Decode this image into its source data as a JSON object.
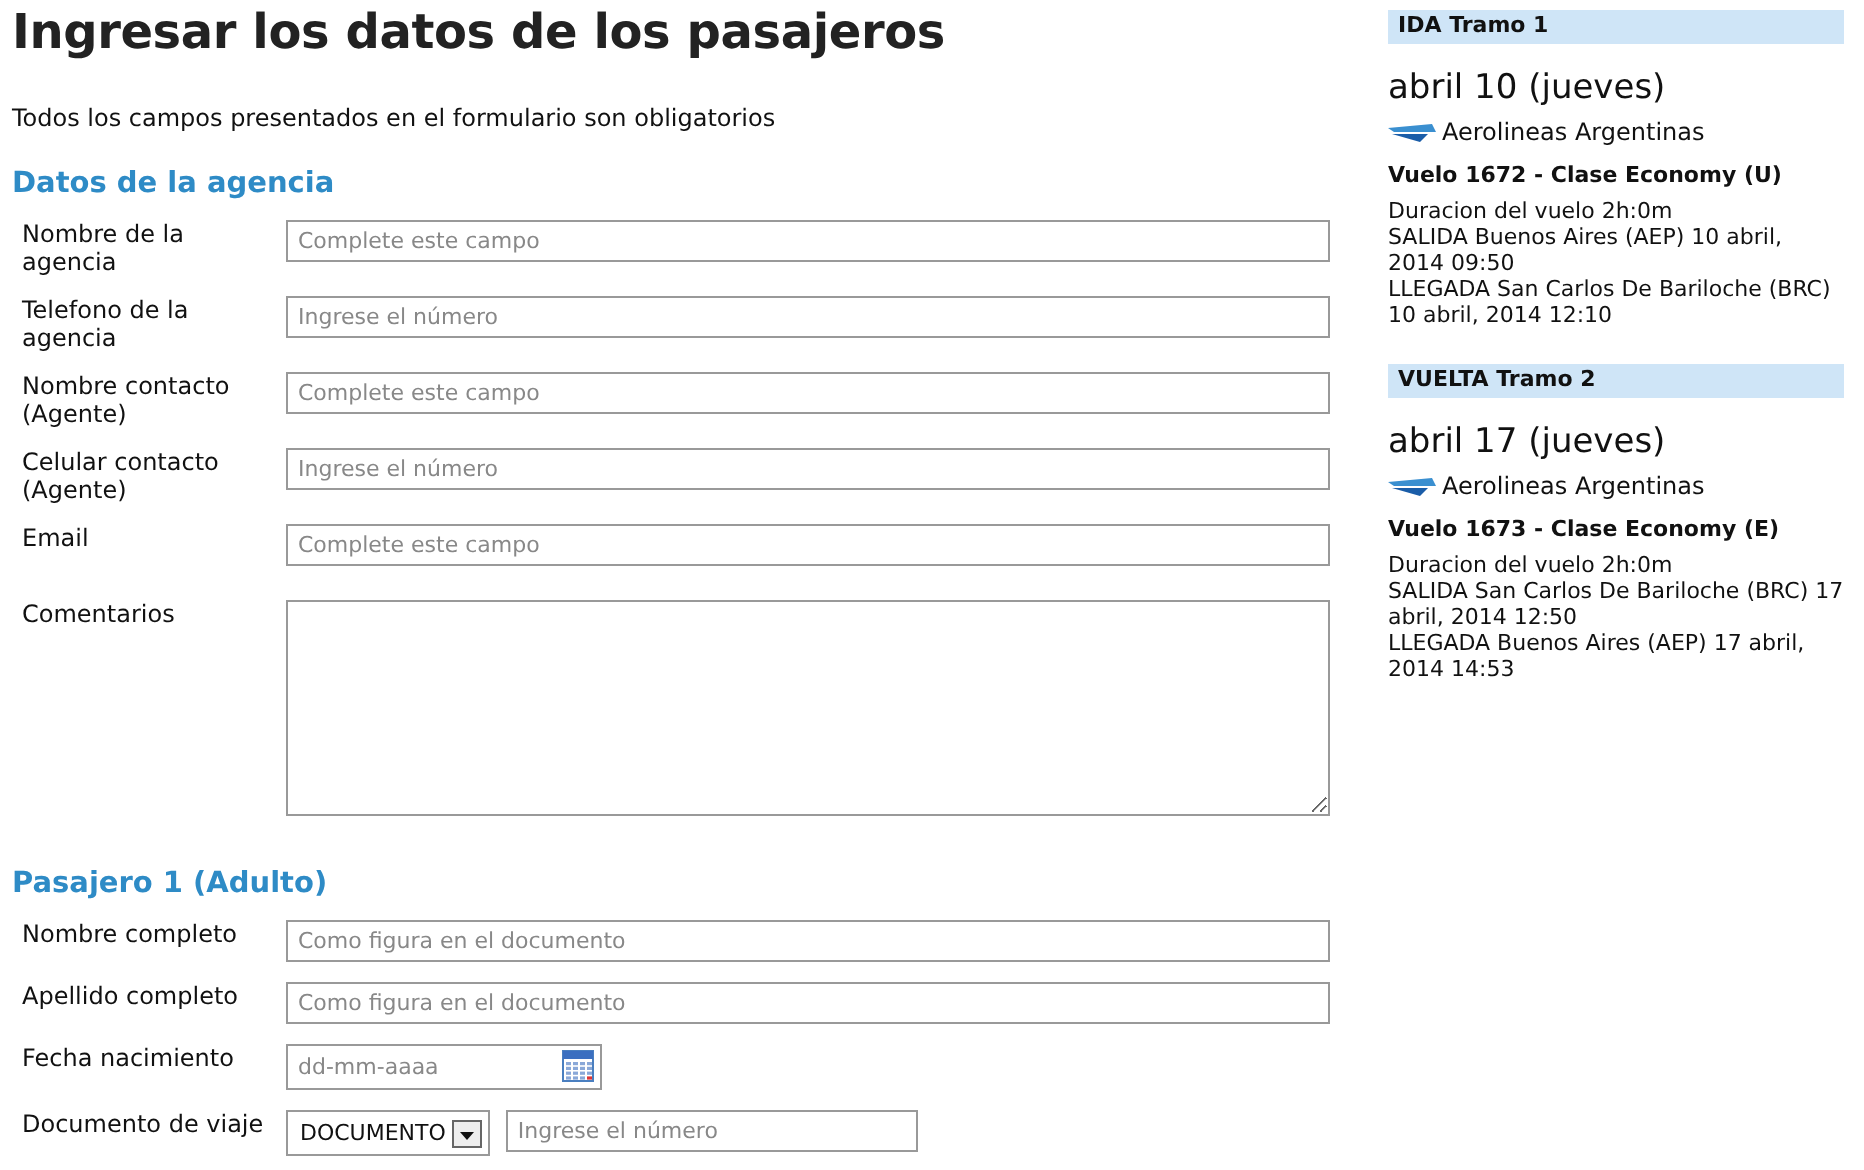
{
  "title": "Ingresar los datos de los pasajeros",
  "note": "Todos los campos presentados en el formulario son obligatorios",
  "sections": [
    {
      "heading": "Datos de la agencia",
      "fields": [
        {
          "kind": "text",
          "label": "Nombre de la agencia",
          "placeholder": "Complete este campo"
        },
        {
          "kind": "text",
          "label": "Telefono de la agencia",
          "placeholder": "Ingrese el número"
        },
        {
          "kind": "text",
          "label": "Nombre contacto (Agente)",
          "placeholder": "Complete este campo"
        },
        {
          "kind": "text",
          "label": "Celular contacto (Agente)",
          "placeholder": "Ingrese el número"
        },
        {
          "kind": "text",
          "label": "Email",
          "placeholder": "Complete este campo"
        },
        {
          "kind": "textarea",
          "label": "Comentarios"
        }
      ]
    },
    {
      "heading": "Pasajero 1 (Adulto)",
      "fields": [
        {
          "kind": "text",
          "label": "Nombre completo",
          "placeholder": "Como figura en el documento"
        },
        {
          "kind": "text",
          "label": "Apellido completo",
          "placeholder": "Como figura en el documento"
        },
        {
          "kind": "date",
          "label": "Fecha nacimiento",
          "placeholder": "dd-mm-aaaa"
        },
        {
          "kind": "document",
          "label": "Documento de viaje",
          "select": "DOCUMENTO",
          "placeholder": "Ingrese el número"
        }
      ]
    }
  ],
  "legs": [
    {
      "header": "IDA Tramo 1",
      "date": "abril 10 (jueves)",
      "airline": "Aerolineas Argentinas",
      "flight": "Vuelo 1672 - Clase Economy (U)",
      "details": [
        "Duracion del vuelo 2h:0m",
        "SALIDA Buenos Aires (AEP) 10 abril, 2014 09:50",
        "LLEGADA San Carlos De Bariloche (BRC) 10 abril, 2014 12:10"
      ]
    },
    {
      "header": "VUELTA Tramo 2",
      "date": "abril 17 (jueves)",
      "airline": "Aerolineas Argentinas",
      "flight": "Vuelo 1673 - Clase Economy (E)",
      "details": [
        "Duracion del vuelo 2h:0m",
        "SALIDA San Carlos De Bariloche (BRC) 17 abril, 2014 12:50",
        "LLEGADA Buenos Aires (AEP) 17 abril, 2014 14:53"
      ]
    }
  ]
}
